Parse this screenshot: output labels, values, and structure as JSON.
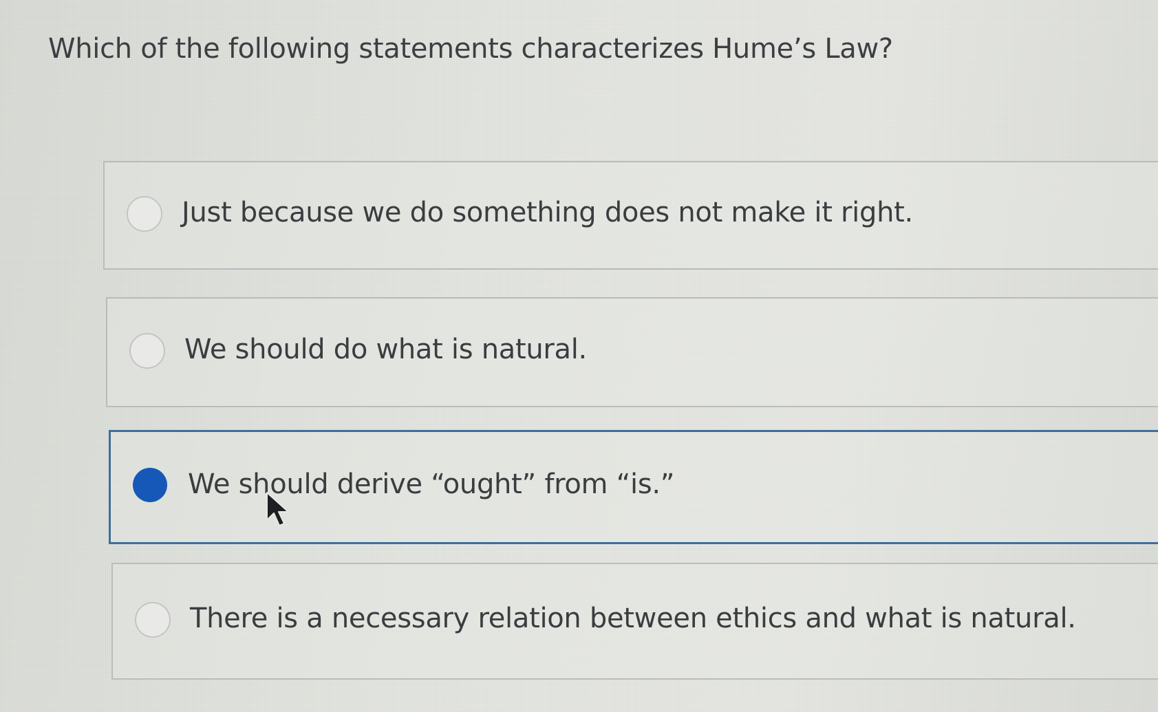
{
  "question": {
    "text": "Which of the following statements characterizes Hume’s Law?"
  },
  "options": [
    {
      "label": "Just because we do something does not make it right.",
      "selected": false
    },
    {
      "label": "We should do what is natural.",
      "selected": false
    },
    {
      "label": "We should derive “ought” from “is.”",
      "selected": true
    },
    {
      "label": "There is a necessary relation between ethics and what is natural.",
      "selected": false
    }
  ],
  "colors": {
    "selected_radio": "#1558b8",
    "selected_border": "#3f6e9a"
  }
}
